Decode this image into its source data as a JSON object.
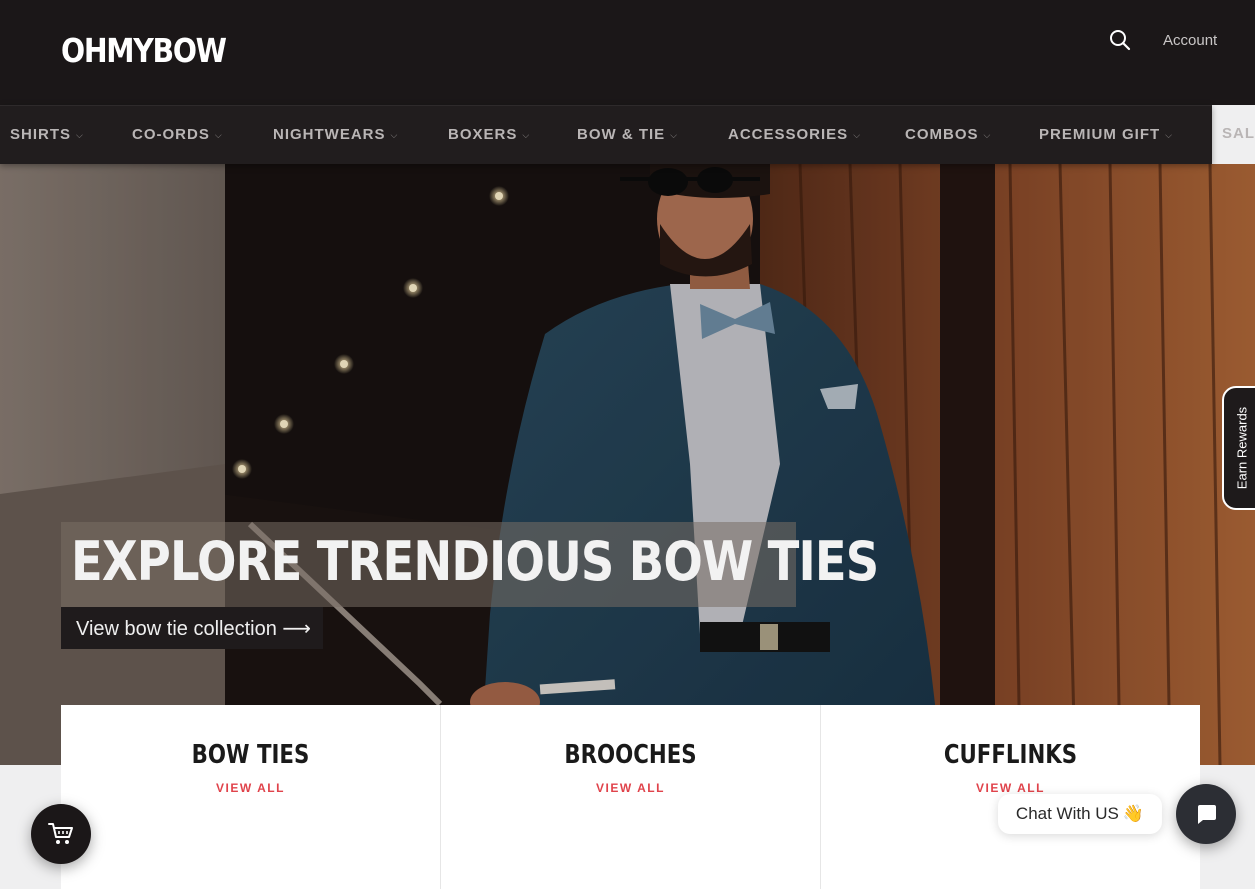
{
  "header": {
    "logo": "OHMYBOW",
    "account_label": "Account",
    "search_icon": "search-icon"
  },
  "nav": {
    "items": [
      {
        "label": "SHIRTS"
      },
      {
        "label": "CO-ORDS"
      },
      {
        "label": "NIGHTWEARS"
      },
      {
        "label": "BOXERS"
      },
      {
        "label": "BOW & TIE"
      },
      {
        "label": "ACCESSORIES"
      },
      {
        "label": "COMBOS"
      },
      {
        "label": "PREMIUM GIFT"
      },
      {
        "label": "SAL"
      }
    ],
    "chevron": "⌵"
  },
  "hero": {
    "title": "EXPLORE TRENDIOUS BOW TIES",
    "cta_label": "View bow tie collection ⟶"
  },
  "rewards": {
    "label": "Earn Rewards"
  },
  "collections": [
    {
      "title": "BOW TIES",
      "link": "VIEW ALL"
    },
    {
      "title": "BROOCHES",
      "link": "VIEW ALL"
    },
    {
      "title": "CUFFLINKS",
      "link": "VIEW ALL"
    }
  ],
  "widgets": {
    "chat_label": "Chat With US",
    "chat_emoji": "👋",
    "cart_icon": "cart-icon",
    "chat_icon": "chat-icon"
  },
  "colors": {
    "header_bg": "#1b1718",
    "nav_bg": "#211d1e",
    "accent_link": "#e0434b"
  }
}
